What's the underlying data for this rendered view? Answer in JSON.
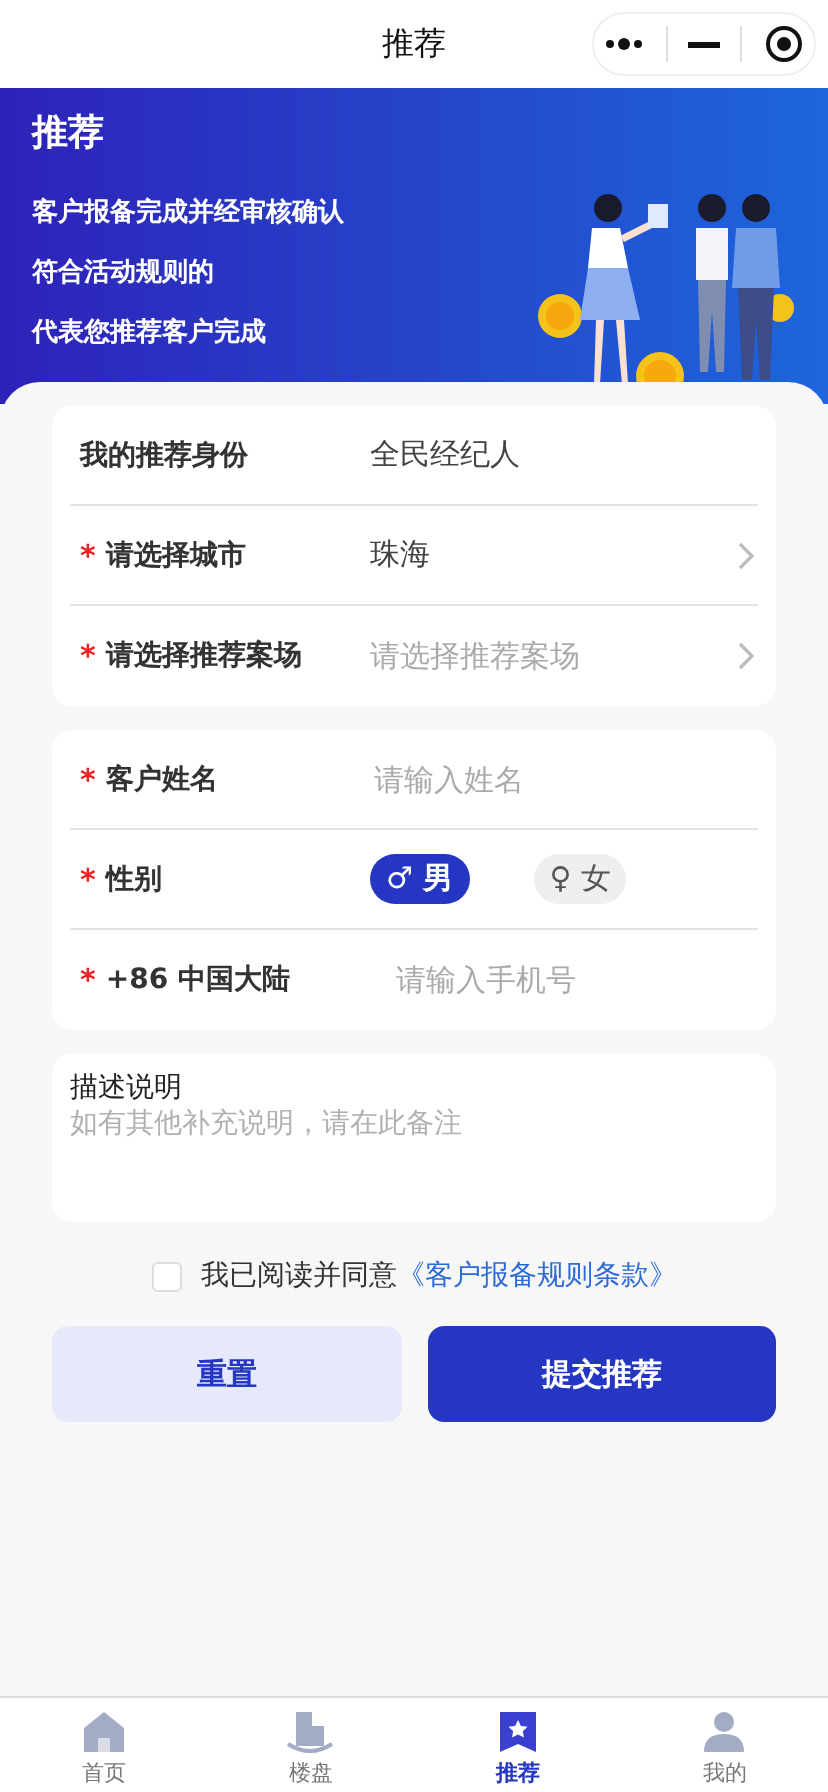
{
  "nav": {
    "title": "推荐"
  },
  "banner": {
    "title": "推荐",
    "lines": [
      "客户报备完成并经审核确认",
      "符合活动规则的",
      "代表您推荐客户完成"
    ]
  },
  "groups": [
    {
      "rows": [
        {
          "kind": "static",
          "label": "我的推荐身份",
          "value": "全民经纪人"
        },
        {
          "kind": "select",
          "required_mark": "*",
          "label": "请选择城市",
          "value": "珠海"
        },
        {
          "kind": "select",
          "required_mark": "*",
          "label": "请选择推荐案场",
          "placeholder": "请选择推荐案场"
        }
      ]
    },
    {
      "rows": [
        {
          "kind": "input",
          "required_mark": "*",
          "label": "客户姓名",
          "placeholder": "请输入姓名"
        },
        {
          "kind": "gender",
          "required_mark": "*",
          "label": "性别",
          "options": [
            {
              "symbol": "♂",
              "label": "男",
              "selected": true
            },
            {
              "symbol": "♀",
              "label": "女",
              "selected": false
            }
          ]
        },
        {
          "kind": "input",
          "required_mark": "*",
          "label": "+86 中国大陆",
          "placeholder": "请输入手机号"
        }
      ]
    }
  ],
  "description": {
    "label": "描述说明",
    "placeholder": "如有其他补充说明，请在此备注"
  },
  "agreement": {
    "checked": false,
    "text": "我已阅读并同意",
    "link": "《客户报备规则条款》"
  },
  "buttons": [
    {
      "kind": "secondary",
      "label": "重置"
    },
    {
      "kind": "primary",
      "label": "提交推荐"
    }
  ],
  "tabbar": [
    {
      "kind": "home",
      "label": "首页",
      "selected": false
    },
    {
      "kind": "building",
      "label": "楼盘",
      "selected": false
    },
    {
      "kind": "star",
      "label": "推荐",
      "selected": true
    },
    {
      "kind": "user",
      "label": "我的",
      "selected": false
    }
  ]
}
